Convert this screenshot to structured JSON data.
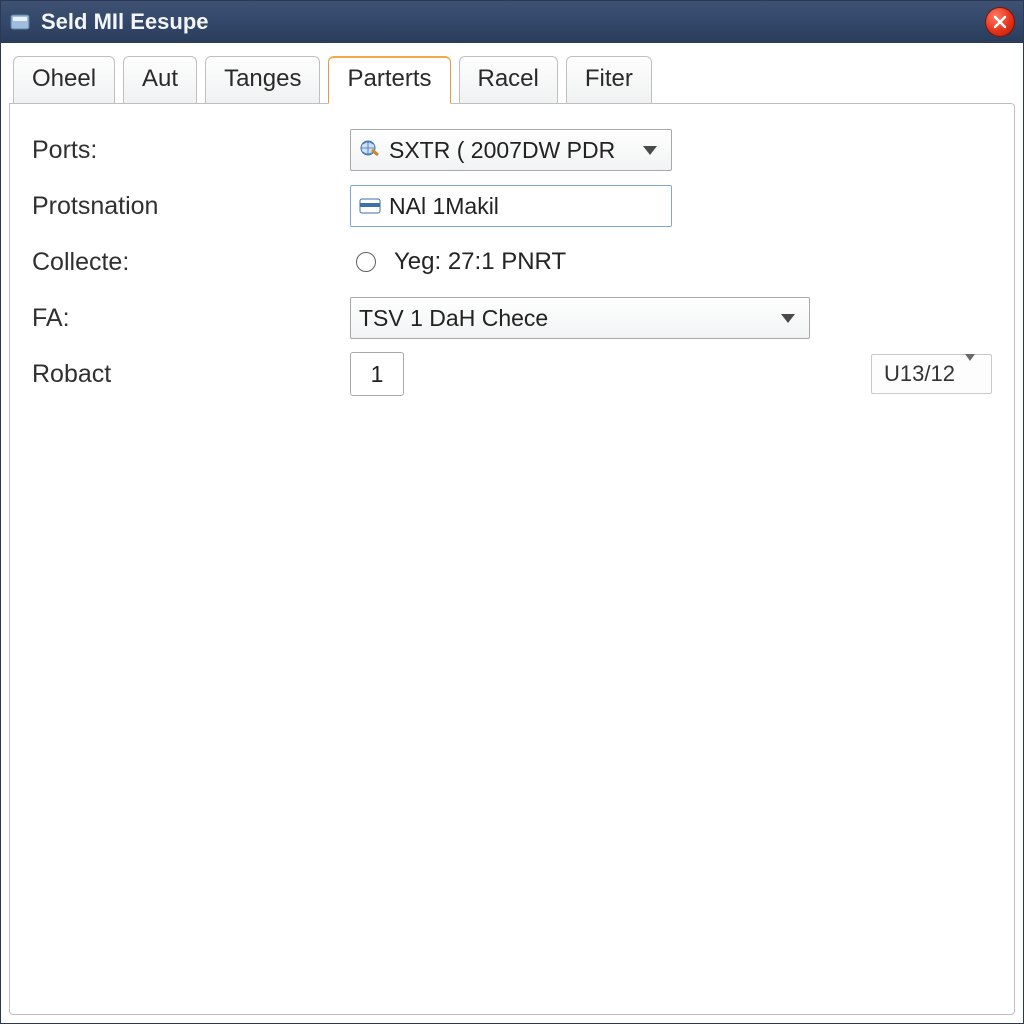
{
  "window": {
    "title": "Seld MIl Eesupe"
  },
  "tabs": [
    {
      "label": "Oheel",
      "active": false
    },
    {
      "label": "Aut",
      "active": false
    },
    {
      "label": "Tanges",
      "active": false
    },
    {
      "label": "Parterts",
      "active": true
    },
    {
      "label": "Racel",
      "active": false
    },
    {
      "label": "Fiter",
      "active": false
    }
  ],
  "form": {
    "ports": {
      "label": "Ports:",
      "value": "SXTR ( 2007DW PDR"
    },
    "protsnation": {
      "label": "Protsnation",
      "value": "NAl 1Makil"
    },
    "collecte": {
      "label": "Collecte:",
      "radio_label": "Yeg: 27:1 PNRT"
    },
    "fa": {
      "label": "FA:",
      "value": "TSV 1 DaH Chece"
    },
    "robact": {
      "label": "Robact",
      "count": "1",
      "unit": "U13/12"
    }
  },
  "icons": {
    "ports": "globe-wrench-icon",
    "protsnation": "card-icon"
  }
}
